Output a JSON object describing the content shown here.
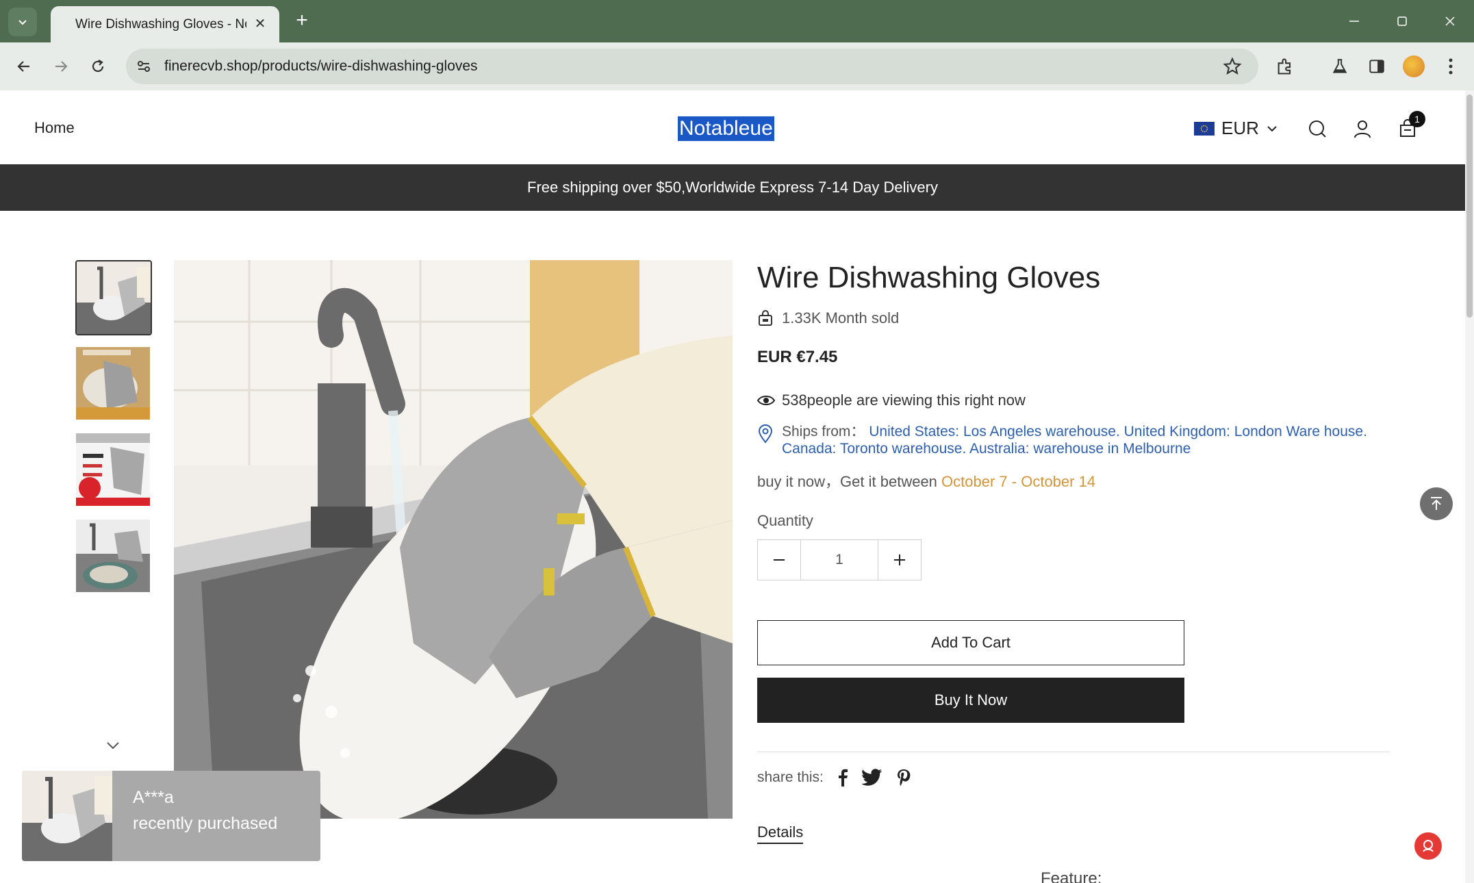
{
  "browser": {
    "tab_title": "Wire Dishwashing Gloves - No",
    "url": "finerecvb.shop/products/wire-dishwashing-gloves"
  },
  "header": {
    "nav_home": "Home",
    "logo": "Notableue",
    "currency": "EUR",
    "cart_count": "1"
  },
  "announcement": "Free shipping over $50,Worldwide Express 7-14 Day Delivery",
  "product": {
    "title": "Wire Dishwashing Gloves",
    "sold": "1.33K Month sold",
    "price": "EUR €7.45",
    "viewing": "538people are viewing this right now",
    "ships_label": "Ships from：",
    "ships_value": "United States: Los Angeles warehouse. United Kingdom: London Ware house. Canada: Toronto warehouse. Australia: warehouse in Melbourne",
    "delivery_prefix": "buy it now，Get it between",
    "date_start": "October 7",
    "date_sep": " - ",
    "date_end": "October 14",
    "quantity_label": "Quantity",
    "quantity_value": "1",
    "add_to_cart": "Add To Cart",
    "buy_now": "Buy It Now",
    "share_label": "share this:",
    "details_tab": "Details",
    "feature_peek": "Feature:"
  },
  "toast": {
    "buyer": "A***a",
    "message": "recently purchased"
  },
  "colors": {
    "browser_frame": "#4f6b50",
    "announcement_bg": "#333333",
    "ships_link": "#2e5fab",
    "date_accent": "#d2953c",
    "buy_button": "#222222"
  }
}
